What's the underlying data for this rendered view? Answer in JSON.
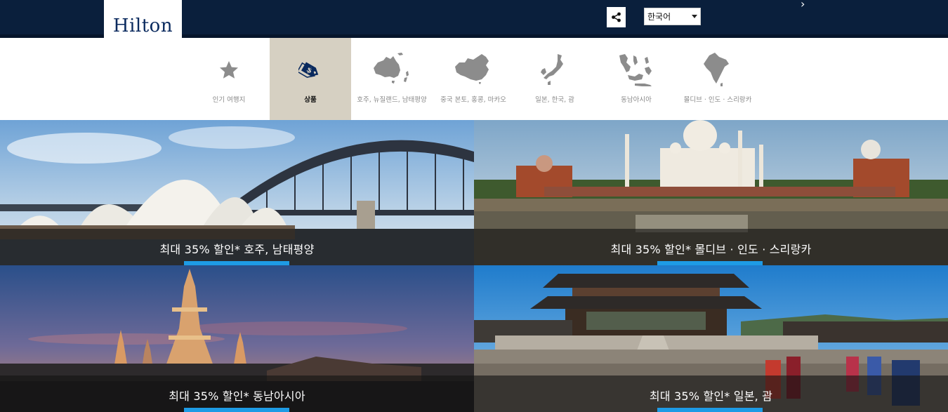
{
  "header": {
    "logo_text": "Hilton",
    "language": {
      "selected": "한국어"
    }
  },
  "nav": {
    "tabs": [
      {
        "label": "인기 여행지",
        "icon": "star-icon",
        "active": false
      },
      {
        "label": "상품",
        "icon": "price-tag-icon",
        "active": true
      },
      {
        "label": "호주, 뉴질랜드, 남태평양",
        "icon": "australia-map-icon",
        "active": false
      },
      {
        "label": "중국 본토, 홍콩, 마카오",
        "icon": "china-map-icon",
        "active": false
      },
      {
        "label": "일본, 한국, 괌",
        "icon": "japan-korea-map-icon",
        "active": false
      },
      {
        "label": "동남아시아",
        "icon": "southeast-asia-map-icon",
        "active": false
      },
      {
        "label": "몰디브 · 인도 · 스리랑카",
        "icon": "india-map-icon",
        "active": false
      }
    ]
  },
  "offers": [
    {
      "text": "최대 35% 할인* 호주, 남태평양",
      "scene": "sydney-opera-house"
    },
    {
      "text": "최대 35% 할인* 몰디브 · 인도 · 스리랑카",
      "scene": "taj-mahal"
    },
    {
      "text": "최대 35% 할인* 동남아시아",
      "scene": "wat-arun"
    },
    {
      "text": "최대 35% 할인* 일본, 괌",
      "scene": "korean-palace"
    }
  ],
  "colors": {
    "header_bg": "#0a1f3c",
    "active_tab": "#d6d0c2",
    "accent_bar": "#1e9be5"
  }
}
